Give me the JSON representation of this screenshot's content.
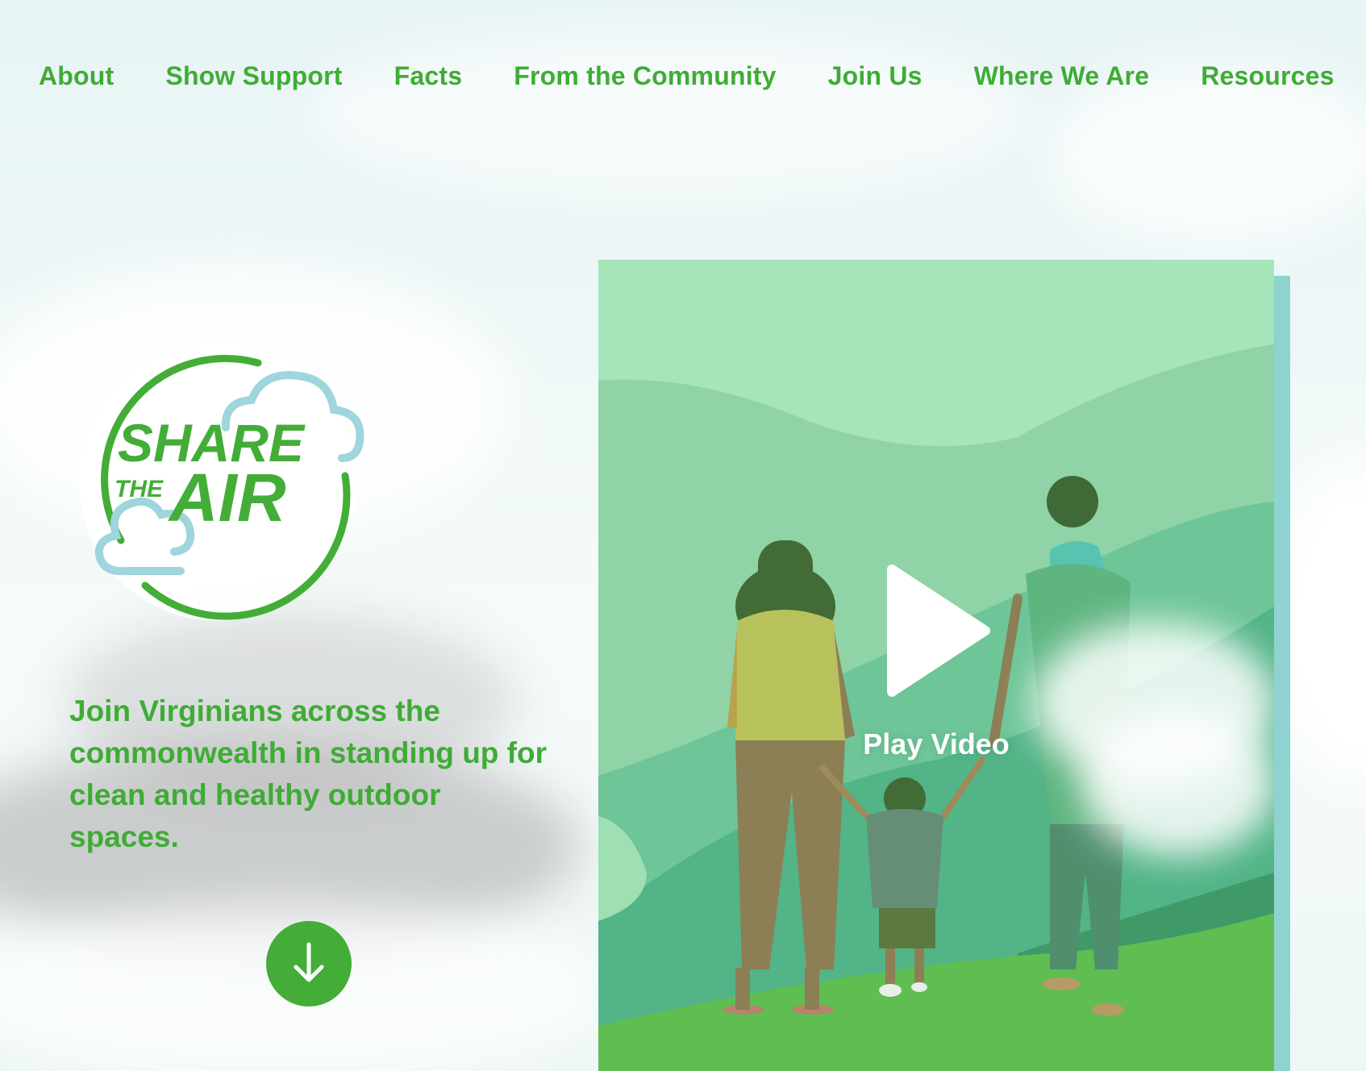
{
  "nav": {
    "items": [
      {
        "label": "About"
      },
      {
        "label": "Show Support"
      },
      {
        "label": "Facts"
      },
      {
        "label": "From the Community"
      },
      {
        "label": "Join Us"
      },
      {
        "label": "Where We Are"
      },
      {
        "label": "Resources"
      }
    ]
  },
  "logo": {
    "line1": "SHARE",
    "line2": "THE",
    "line3": "AIR"
  },
  "hero": {
    "tagline": "Join Virginians across the commonwealth in standing up for clean and healthy outdoor spaces."
  },
  "scroll_button": {
    "icon": "arrow-down-icon"
  },
  "video": {
    "play_label": "Play Video",
    "play_icon": "play-icon"
  },
  "colors": {
    "brand_green": "#3fac35",
    "cloud_blue": "#9fd5dc",
    "video_bg": "#a6e5ba"
  }
}
